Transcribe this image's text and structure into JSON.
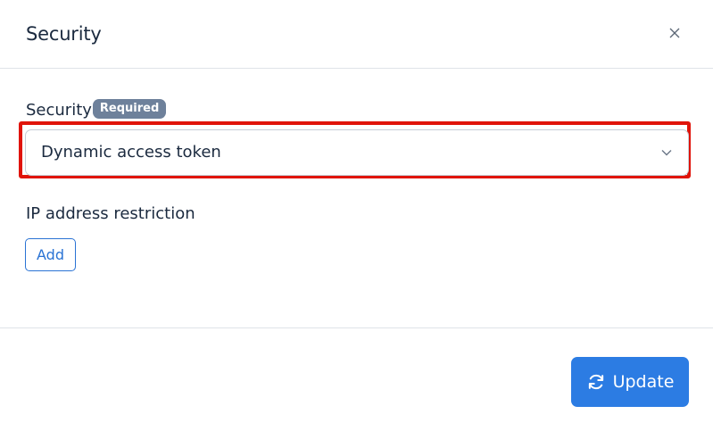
{
  "dialog": {
    "title": "Security"
  },
  "security_field": {
    "label": "Security",
    "required_badge": "Required",
    "selected_value": "Dynamic access token"
  },
  "ip_restriction": {
    "label": "IP address restriction",
    "add_label": "Add"
  },
  "footer": {
    "update_label": "Update"
  },
  "icons": {
    "close": "close-icon",
    "chevron": "chevron-down-icon",
    "refresh": "refresh-icon"
  },
  "colors": {
    "primary": "#2c7ce3",
    "highlight": "#e0140a",
    "badge": "#6e819b"
  }
}
